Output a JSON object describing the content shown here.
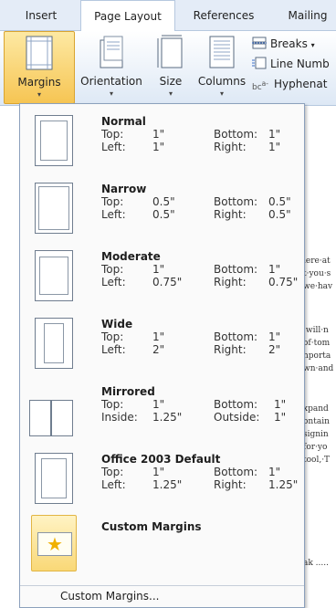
{
  "tabs": {
    "insert": "Insert",
    "page_layout": "Page Layout",
    "references": "References",
    "mailings": "Mailing"
  },
  "ribbon": {
    "margins": "Margins",
    "orientation": "Orientation",
    "size": "Size",
    "columns": "Columns",
    "breaks": "Breaks",
    "breaks_arrow": "▾",
    "line_numbers": "Line Numb",
    "hyphenation": "Hyphenat",
    "dropdown_arrow": "▾"
  },
  "menu": {
    "presets": [
      {
        "name": "Normal",
        "r1l": "Top:",
        "r1v": "1\"",
        "r1l2": "Bottom:",
        "r1v2": "1\"",
        "r2l": "Left:",
        "r2v": "1\"",
        "r2l2": "Right:",
        "r2v2": "1\""
      },
      {
        "name": "Narrow",
        "r1l": "Top:",
        "r1v": "0.5\"",
        "r1l2": "Bottom:",
        "r1v2": "0.5\"",
        "r2l": "Left:",
        "r2v": "0.5\"",
        "r2l2": "Right:",
        "r2v2": "0.5\""
      },
      {
        "name": "Moderate",
        "r1l": "Top:",
        "r1v": "1\"",
        "r1l2": "Bottom:",
        "r1v2": "1\"",
        "r2l": "Left:",
        "r2v": "0.75\"",
        "r2l2": "Right:",
        "r2v2": "0.75\""
      },
      {
        "name": "Wide",
        "r1l": "Top:",
        "r1v": "1\"",
        "r1l2": "Bottom:",
        "r1v2": "1\"",
        "r2l": "Left:",
        "r2v": "2\"",
        "r2l2": "Right:",
        "r2v2": "2\""
      },
      {
        "name": "Mirrored",
        "r1l": "Top:",
        "r1v": "1\"",
        "r1l2": "Bottom:",
        "r1v2": "1\"",
        "r2l": "Inside:",
        "r2v": "1.25\"",
        "r2l2": "Outside:",
        "r2v2": "1\""
      },
      {
        "name": "Office 2003 Default",
        "r1l": "Top:",
        "r1v": "1\"",
        "r1l2": "Bottom:",
        "r1v2": "1\"",
        "r2l": "Left:",
        "r2v": "1.25\"",
        "r2l2": "Right:",
        "r2v2": "1.25\""
      }
    ],
    "custom_item": "Custom Margins",
    "custom_footer": "Custom Margins..."
  },
  "document_fragments": [
    "lere·at",
    "t·you·s",
    "we·hav",
    "·will·n",
    "of·tom",
    "nporta",
    "wn·and",
    "xpand",
    "ontain",
    "signin",
    "for·yo",
    "tool,·T",
    "ak ....."
  ]
}
